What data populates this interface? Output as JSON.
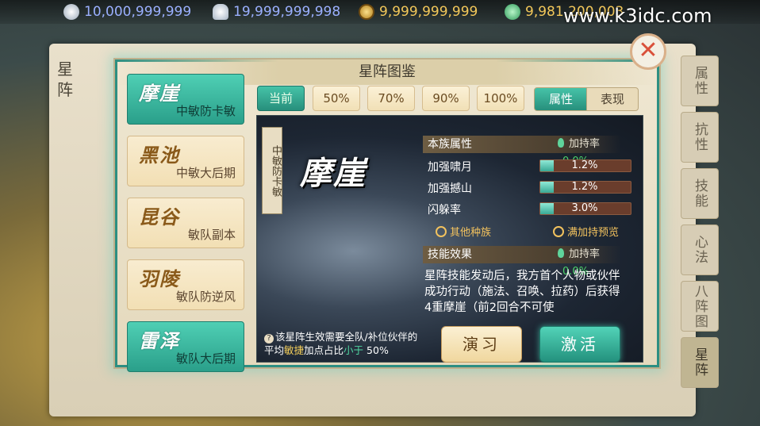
{
  "currencies": [
    {
      "name": "silver-coin",
      "value": "10,000,999,999",
      "color": "#9bb0ff"
    },
    {
      "name": "silver-ingot",
      "value": "19,999,999,998",
      "color": "#9bb0ff"
    },
    {
      "name": "copper-coin",
      "value": "9,999,999,999",
      "color": "#f3c85a"
    },
    {
      "name": "jade",
      "value": "9,981,200,003",
      "color": "#f3c85a"
    }
  ],
  "watermark": "www.k3idc.com",
  "background": {
    "side_title": "星阵",
    "right_tabs": [
      "属性",
      "抗性",
      "技能",
      "心法",
      "八阵图",
      "星阵"
    ]
  },
  "dialog": {
    "title": "星阵图鉴",
    "close_label": "✕"
  },
  "formations": [
    {
      "name": "摩崖",
      "desc": "中敏防卡敏",
      "active": true
    },
    {
      "name": "黑池",
      "desc": "中敏大后期",
      "active": false
    },
    {
      "name": "昆谷",
      "desc": "敏队副本",
      "active": false
    },
    {
      "name": "羽陵",
      "desc": "敏队防逆风",
      "active": false
    },
    {
      "name": "雷泽",
      "desc": "敏队大后期",
      "active": false
    }
  ],
  "pct_tabs": [
    "当前",
    "50%",
    "70%",
    "90%",
    "100%"
  ],
  "view_tabs": [
    "属性",
    "表现"
  ],
  "detail": {
    "vert_label": "中敏防卡敏",
    "big_name": "摩崖",
    "attr_section": "本族属性",
    "rate_label": "加持率",
    "rate_value": "0.0%",
    "attrs": [
      {
        "label": "加强啸月",
        "value": "1.2%",
        "fill": 0.15
      },
      {
        "label": "加强撼山",
        "value": "1.2%",
        "fill": 0.15
      },
      {
        "label": "闪躲率",
        "value": "3.0%",
        "fill": 0.15
      }
    ],
    "link_other": "其他种族",
    "link_full": "满加持预览",
    "skill_section": "技能效果",
    "skill_rate_label": "加持率",
    "skill_rate_value": "0.0%",
    "skill_text": "星阵技能发动后，我方首个人物或伙伴成功行动（施法、召唤、拉药）后获得4重摩崖（前2回合不可使",
    "note_prefix": "该星阵生效需要全队/补位伙伴的平均",
    "note_attr": "敏捷",
    "note_mid": "加点占比",
    "note_cmp": "小于",
    "note_val": "50%"
  },
  "buttons": {
    "practice": "演习",
    "activate": "激活"
  }
}
